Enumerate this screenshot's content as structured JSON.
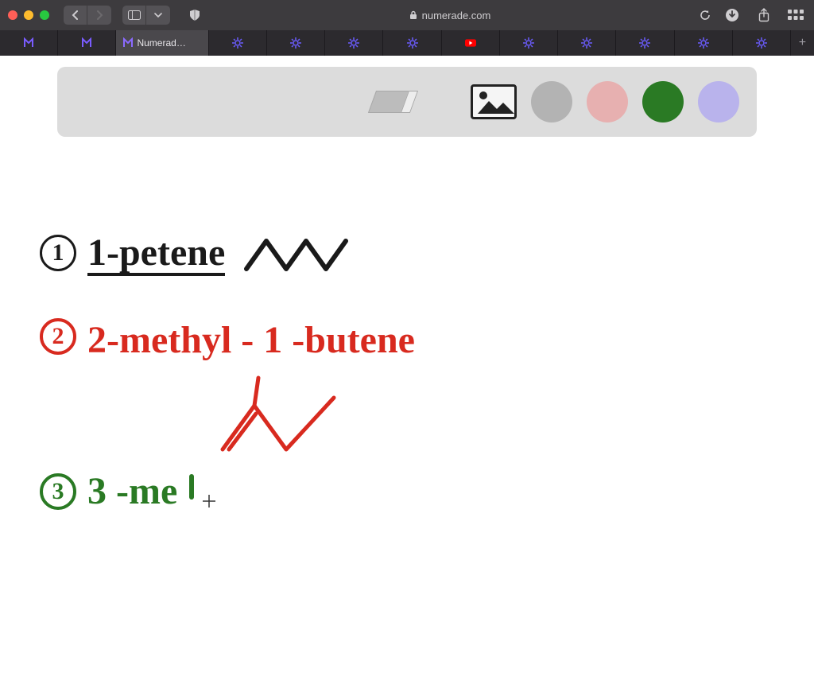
{
  "browser": {
    "url_host": "numerade.com",
    "back_enabled": true,
    "forward_enabled": false
  },
  "tabs": {
    "active_index": 2,
    "items": [
      {
        "kind": "purple-fav"
      },
      {
        "kind": "purple-fav"
      },
      {
        "kind": "purple-fav",
        "label": "Numerad…",
        "active": true
      },
      {
        "kind": "gear"
      },
      {
        "kind": "gear"
      },
      {
        "kind": "gear"
      },
      {
        "kind": "gear"
      },
      {
        "kind": "youtube"
      },
      {
        "kind": "gear"
      },
      {
        "kind": "gear"
      },
      {
        "kind": "gear"
      },
      {
        "kind": "gear"
      },
      {
        "kind": "gear"
      }
    ]
  },
  "whiteboard_toolbar": {
    "colors": {
      "gray": "#b3b3b3",
      "pink": "#e7b0b0",
      "green": "#2a7a24",
      "lavender": "#b9b3ec"
    }
  },
  "notes": {
    "item1": {
      "num": "1",
      "text": "1-petene"
    },
    "item2": {
      "num": "2",
      "text": "2-methyl - 1 -butene"
    },
    "item3": {
      "num": "3",
      "text": "3 -me"
    }
  }
}
